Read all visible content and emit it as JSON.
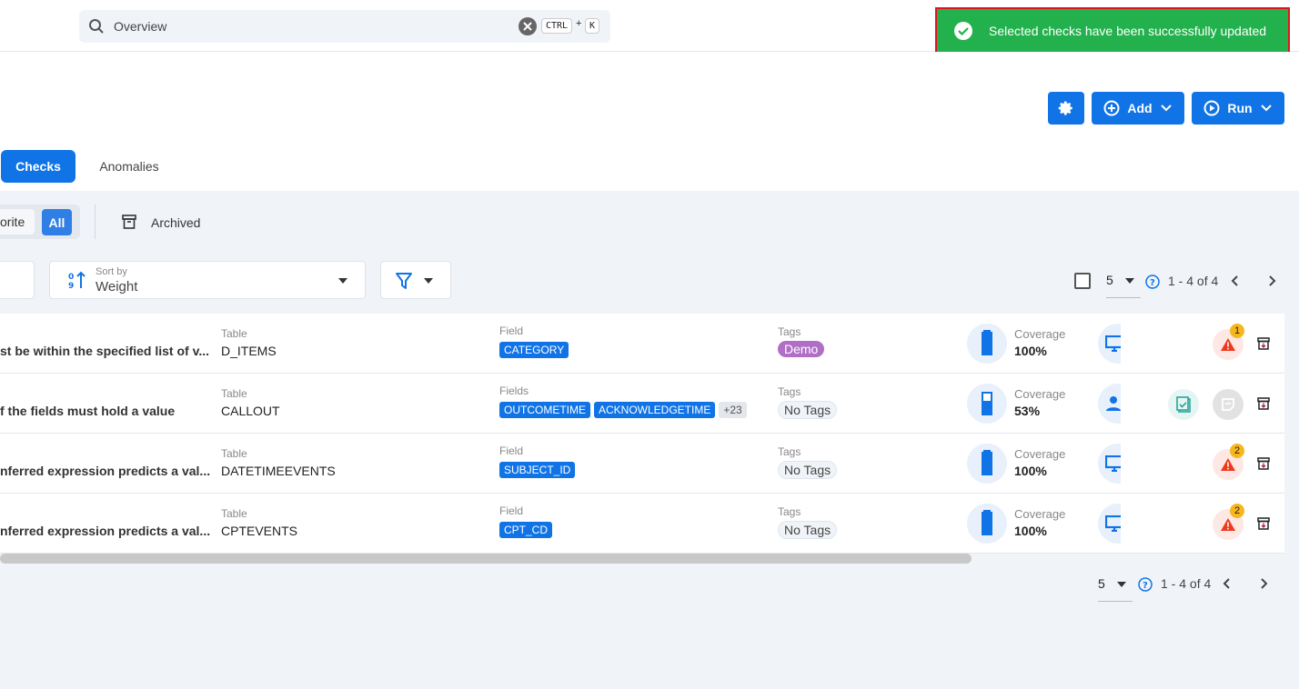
{
  "header": {
    "search_value": "Overview",
    "kbd_ctrl": "CTRL",
    "kbd_plus": "+",
    "kbd_k": "K"
  },
  "toast": {
    "message": "Selected checks have been successfully updated",
    "color": "#23b14d"
  },
  "toolbar": {
    "add_label": "Add",
    "run_label": "Run"
  },
  "tabs": [
    {
      "label": "Checks",
      "active": true
    },
    {
      "label": "Anomalies"
    }
  ],
  "filters": {
    "favorite_label": "orite",
    "all_label": "All",
    "archived_label": "Archived",
    "sort_label": "Sort by",
    "sort_value": "Weight"
  },
  "pagination": {
    "page_size": "5",
    "range": "1 - 4 of 4"
  },
  "rows": [
    {
      "description": "st be within the specified list of v...",
      "table_label": "Table",
      "table": "D_ITEMS",
      "field_label": "Field",
      "fields": [
        "CATEGORY"
      ],
      "more": "",
      "tags_label": "Tags",
      "tag": "Demo",
      "coverage_label": "Coverage",
      "coverage": "100%",
      "coverage_value": 100,
      "anomalies": "1"
    },
    {
      "description": "f the fields must hold a value",
      "table_label": "Table",
      "table": "CALLOUT",
      "field_label": "Fields",
      "fields": [
        "OUTCOMETIME",
        "ACKNOWLEDGETIME"
      ],
      "more": "+23",
      "tags_label": "Tags",
      "tag": "No Tags",
      "coverage_label": "Coverage",
      "coverage": "53%",
      "coverage_value": 53,
      "anomalies": ""
    },
    {
      "description": "nferred expression predicts a val...",
      "table_label": "Table",
      "table": "DATETIMEEVENTS",
      "field_label": "Field",
      "fields": [
        "SUBJECT_ID"
      ],
      "more": "",
      "tags_label": "Tags",
      "tag": "No Tags",
      "coverage_label": "Coverage",
      "coverage": "100%",
      "coverage_value": 100,
      "anomalies": "2"
    },
    {
      "description": "nferred expression predicts a val...",
      "table_label": "Table",
      "table": "CPTEVENTS",
      "field_label": "Field",
      "fields": [
        "CPT_CD"
      ],
      "more": "",
      "tags_label": "Tags",
      "tag": "No Tags",
      "coverage_label": "Coverage",
      "coverage": "100%",
      "coverage_value": 100,
      "anomalies": "2"
    }
  ]
}
